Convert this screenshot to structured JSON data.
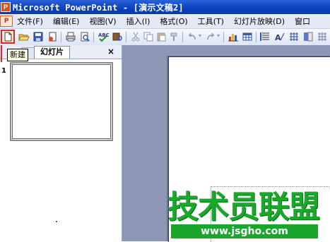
{
  "window": {
    "app_icon_label": "P",
    "title": "Microsoft PowerPoint - [演示文稿2]"
  },
  "menubar": {
    "logo_label": "P",
    "items": [
      "文件(F)",
      "编辑(E)",
      "视图(V)",
      "插入(I)",
      "格式(O)",
      "工具(T)",
      "幻灯片放映(D)",
      "窗口"
    ]
  },
  "toolbar": {
    "tooltip": "新建",
    "highlight_color": "#e8202a"
  },
  "left_pane": {
    "tab_active": "幻灯片",
    "close_label": "×",
    "slide_number": "1"
  },
  "watermark": {
    "text": "技术员联盟",
    "url": "www.jsgho.com",
    "color": "#1aa62c"
  }
}
